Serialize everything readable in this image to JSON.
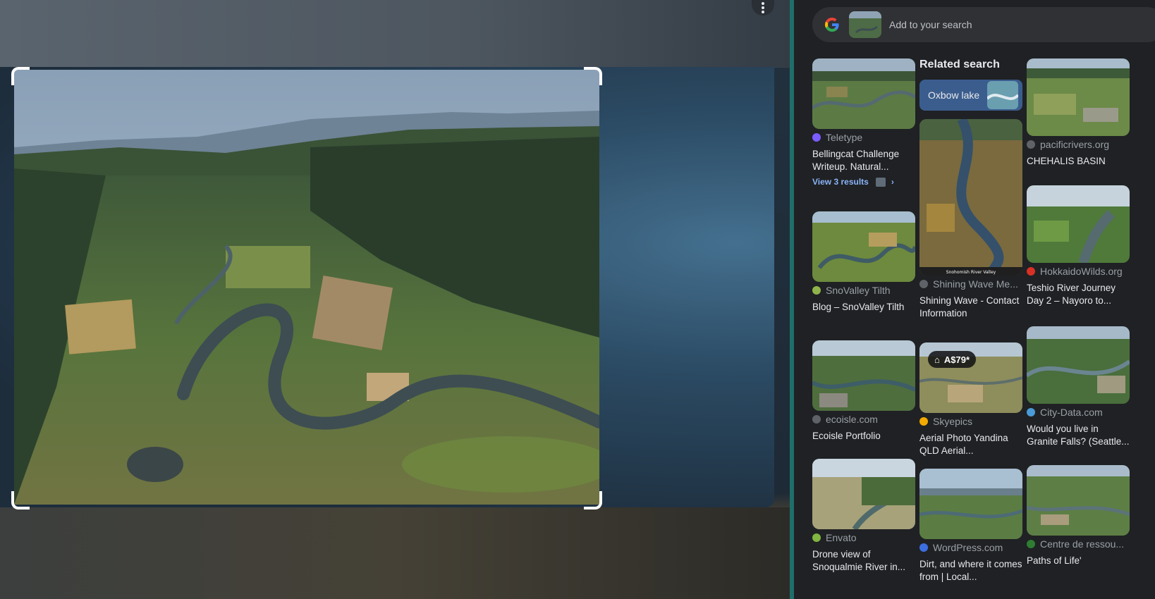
{
  "viewer": {
    "more_options_icon": "more-vert-icon",
    "selected_image_alt": "Aerial view of a meandering river through farmland"
  },
  "search": {
    "placeholder": "Add to your search",
    "logo_icon": "google-g-icon"
  },
  "results": {
    "col1": [
      {
        "source": "Teletype",
        "title": "Bellingcat Challenge Writeup. Natural...",
        "favicon_color": "#7b5cff",
        "view_more": "View 3 results"
      },
      {
        "source": "SnoValley Tilth",
        "title": "Blog – SnoValley Tilth",
        "favicon_color": "#8fb34a"
      },
      {
        "source": "ecoisle.com",
        "title": "Ecoisle Portfolio",
        "favicon_color": "#5f6368"
      },
      {
        "source": "Envato",
        "title": "Drone view of Snoqualmie River in...",
        "favicon_color": "#81b441"
      }
    ],
    "col2": {
      "related_heading": "Related search",
      "chip_label": "Oxbow lake",
      "items": [
        {
          "source": "Shining Wave Me...",
          "title": "Shining Wave - Contact Information",
          "favicon_color": "#5f6368",
          "image_caption": "Snohomish River Valley"
        },
        {
          "source": "Skyepics",
          "title": "Aerial Photo Yandina QLD Aerial...",
          "favicon_color": "#f2a900",
          "price": "A$79*"
        },
        {
          "source": "WordPress.com",
          "title": "Dirt, and where it comes from | Local...",
          "favicon_color": "#3c6ee0"
        }
      ]
    },
    "col3": [
      {
        "source": "pacificrivers.org",
        "title": "CHEHALIS BASIN",
        "favicon_color": "#5f6368"
      },
      {
        "source": "HokkaidoWilds.org",
        "title": "Teshio River Journey Day 2 – Nayoro to...",
        "favicon_color": "#d93025"
      },
      {
        "source": "City-Data.com",
        "title": "Would you live in Granite Falls? (Seattle...",
        "favicon_color": "#4a9bd8"
      },
      {
        "source": "Centre de ressou...",
        "title": "Paths of Life'",
        "favicon_color": "#2e7d32"
      }
    ]
  },
  "colors": {
    "panel_bg": "#1f2124",
    "accent_border": "#1e6e6a",
    "chip_bg": "#3b5d8e",
    "link": "#8ab4f8"
  }
}
